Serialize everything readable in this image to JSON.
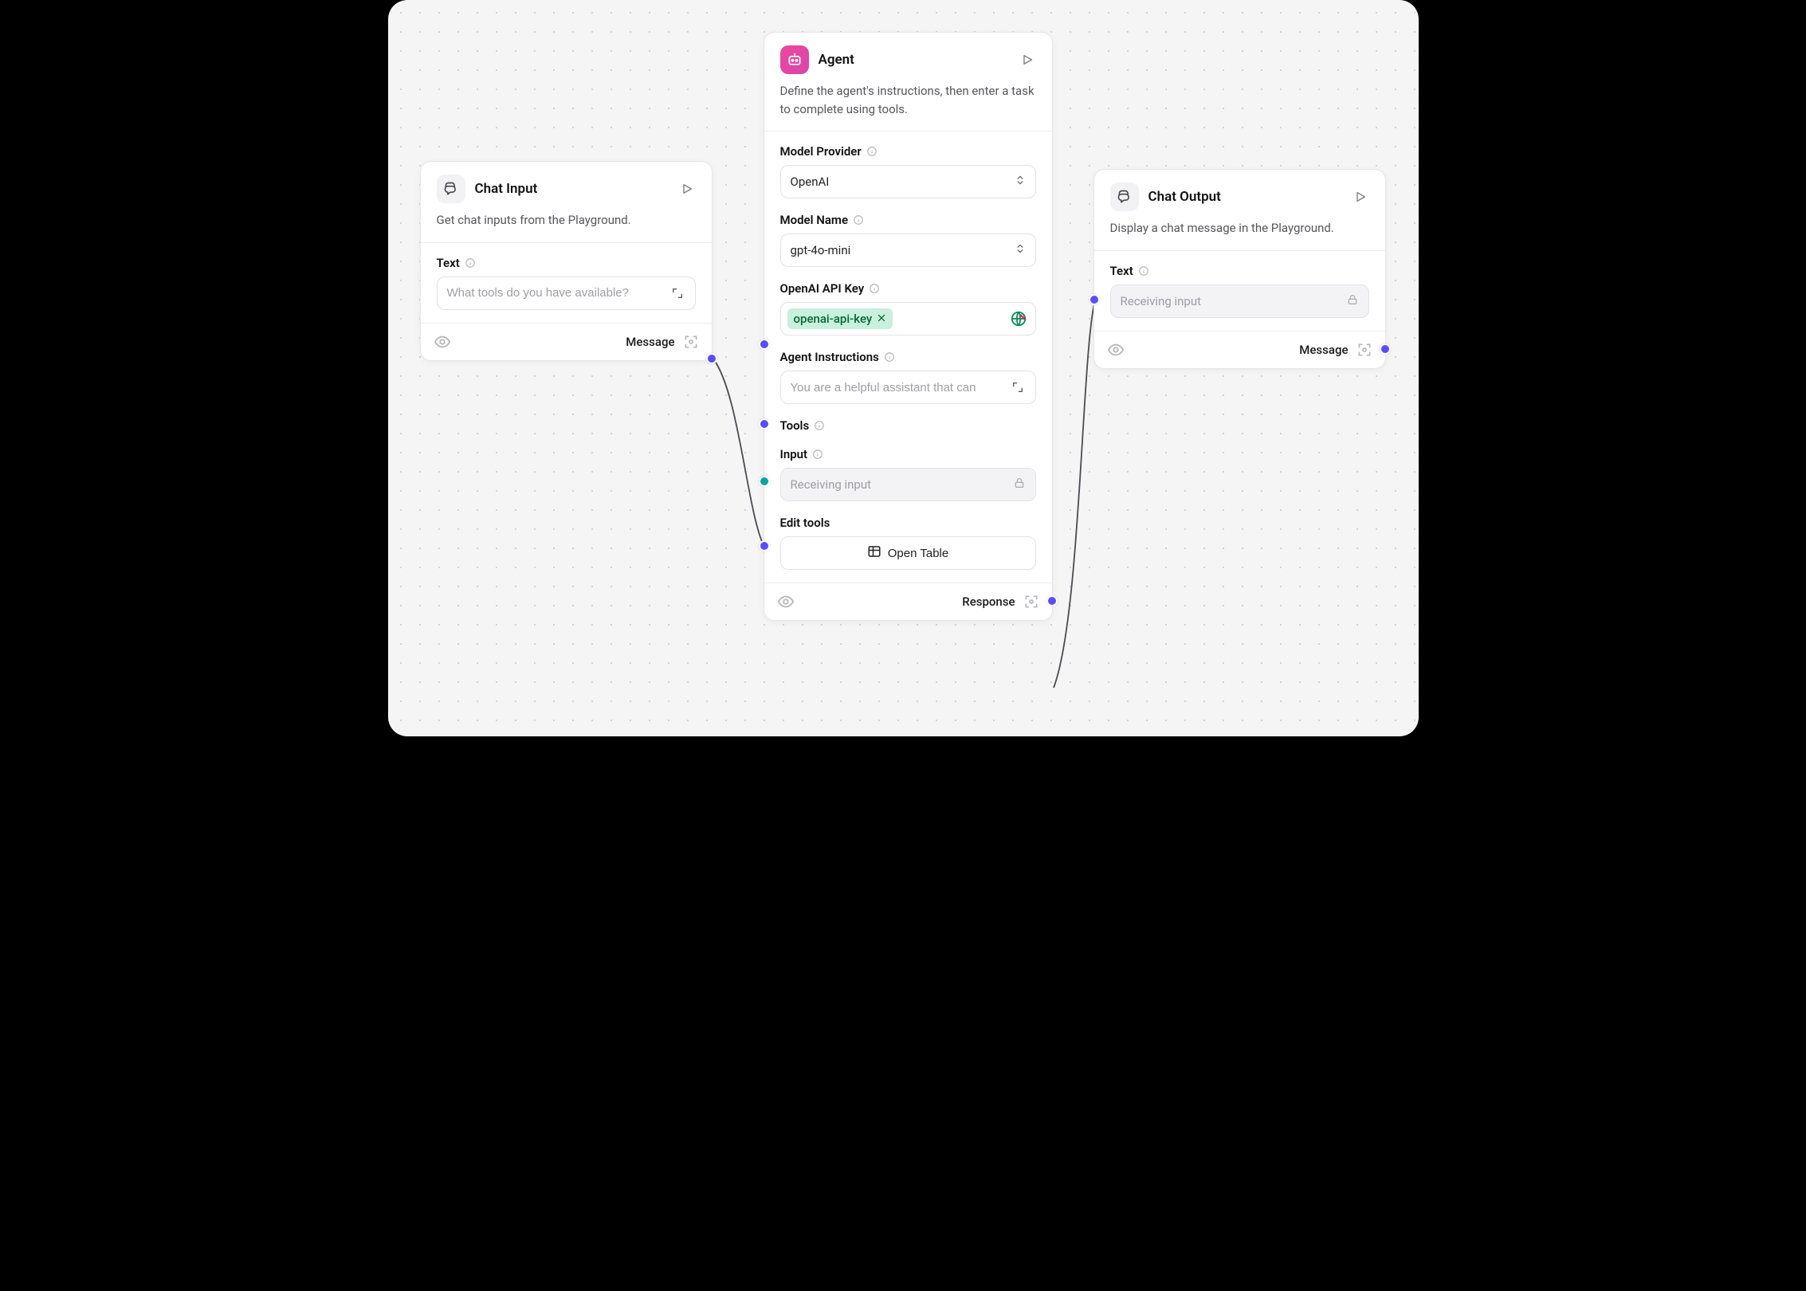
{
  "nodes": {
    "chat_input": {
      "title": "Chat Input",
      "description": "Get chat inputs from the Playground.",
      "fields": {
        "text": {
          "label": "Text",
          "placeholder": "What tools do you have available?"
        }
      },
      "output_label": "Message"
    },
    "agent": {
      "title": "Agent",
      "description": "Define the agent's instructions, then enter a task to complete using tools.",
      "model_provider": {
        "label": "Model Provider",
        "value": "OpenAI"
      },
      "model_name": {
        "label": "Model Name",
        "value": "gpt-4o-mini"
      },
      "api_key": {
        "label": "OpenAI API Key",
        "chip": "openai-api-key"
      },
      "agent_instructions": {
        "label": "Agent Instructions",
        "placeholder": "You are a helpful assistant that can"
      },
      "tools": {
        "label": "Tools"
      },
      "input": {
        "label": "Input",
        "placeholder": "Receiving input"
      },
      "edit_tools": {
        "label": "Edit tools",
        "button": "Open Table"
      },
      "output_label": "Response"
    },
    "chat_output": {
      "title": "Chat Output",
      "description": "Display a chat message in the Playground.",
      "fields": {
        "text": {
          "label": "Text",
          "placeholder": "Receiving input"
        }
      },
      "output_label": "Message"
    }
  }
}
